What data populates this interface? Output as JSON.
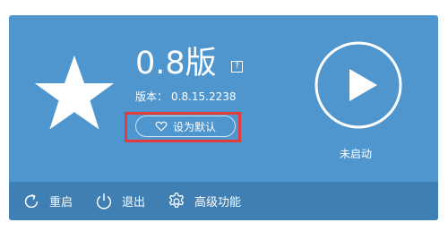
{
  "main": {
    "edition": "0.8版",
    "help_glyph": "?",
    "version_label": "版本：",
    "version_value": "0.8.15.2238",
    "set_default_label": "设为默认",
    "status_label": "未启动"
  },
  "footer": {
    "restart_label": "重启",
    "exit_label": "退出",
    "advanced_label": "高级功能"
  },
  "icons": {
    "star": "star-icon",
    "help": "question-mark-icon",
    "heart": "heart-icon",
    "play": "play-icon",
    "restart": "restart-icon",
    "exit": "power-icon",
    "advanced": "gear-icon"
  },
  "colors": {
    "panel": "#4f96cf",
    "footer": "#3f7fb3",
    "highlight": "#e23b3b",
    "text": "#ffffff"
  }
}
